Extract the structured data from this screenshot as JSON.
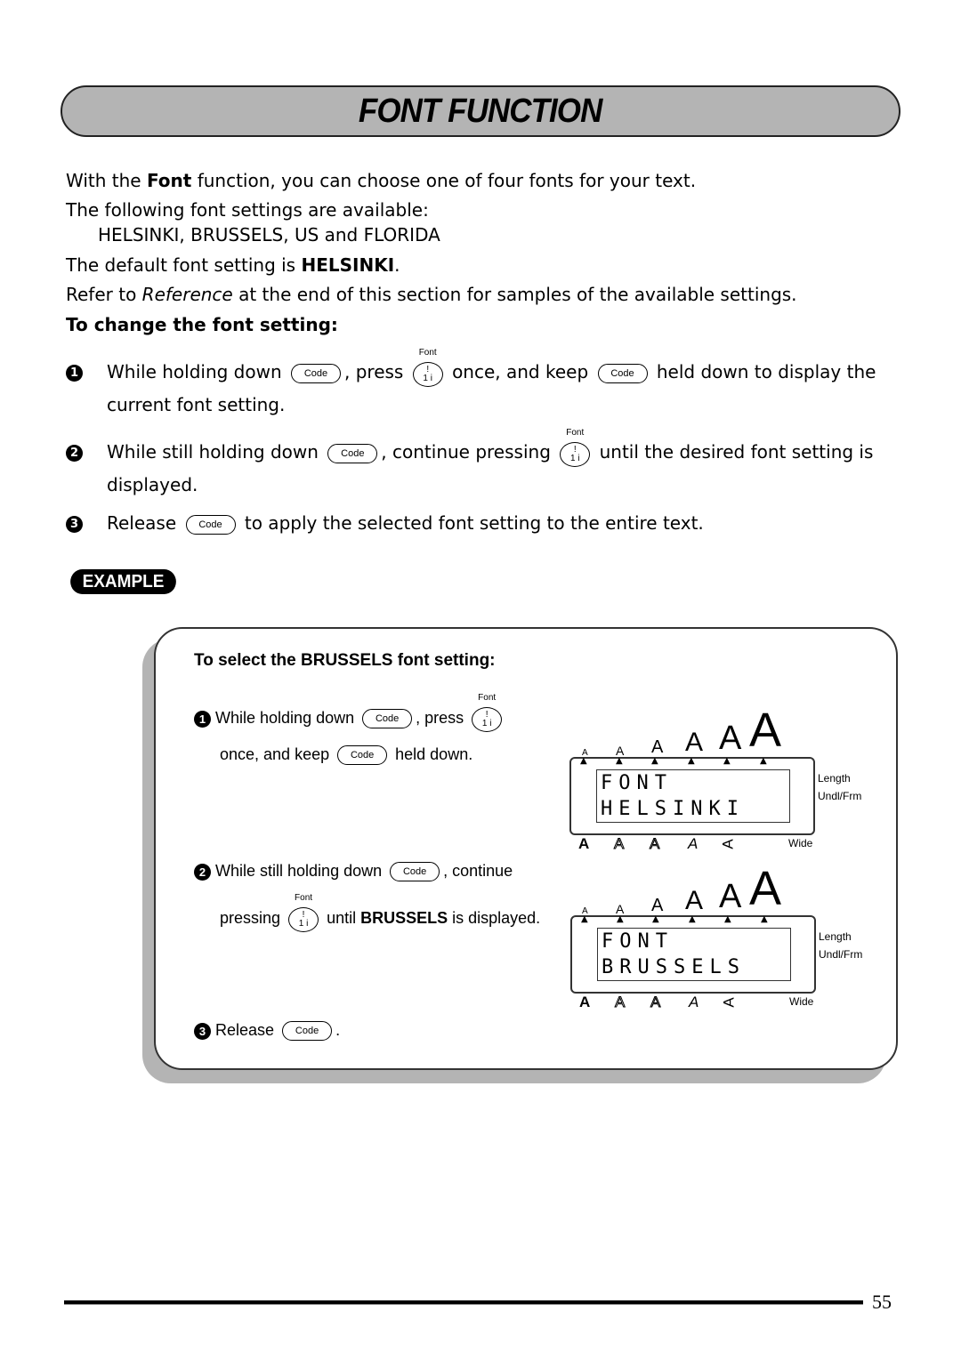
{
  "title": "FONT FUNCTION",
  "intro": {
    "line1_pre": "With the ",
    "line1_bold": "Font",
    "line1_post": " function, you can choose one of four fonts for your text.",
    "line2": "The following font settings are available:",
    "line3": "HELSINKI, BRUSSELS, US and FLORIDA",
    "line4_pre": "The default font setting is ",
    "line4_bold": "HELSINKI",
    "line4_post": ".",
    "line5_pre": "Refer to ",
    "line5_italic": "Reference",
    "line5_post": " at the end of this section for samples of the available settings.",
    "subheading": "To change the font setting:"
  },
  "keys": {
    "code": "Code",
    "font_label": "Font",
    "font_glyph_top": "!",
    "font_glyph_bottom": "1 i"
  },
  "steps": [
    {
      "num": "1",
      "a": "While holding down",
      "b": ", press",
      "c": "once, and keep",
      "d": "held down to display the",
      "e": "current font setting."
    },
    {
      "num": "2",
      "a": "While still holding down",
      "b": ", continue pressing",
      "c": "until the desired font setting is",
      "d": "displayed."
    },
    {
      "num": "3",
      "a": "Release",
      "b": "to apply the selected font setting to the entire text."
    }
  ],
  "example": {
    "badge": "EXAMPLE",
    "title": "To select the BRUSSELS font setting:",
    "step1": {
      "num": "1",
      "a": "While holding down",
      "b": ", press",
      "c": "once, and keep",
      "d": "held down."
    },
    "step2": {
      "num": "2",
      "a": "While still holding down",
      "b": ", continue",
      "c": "pressing",
      "d": "until ",
      "d_bold": "BRUSSELS",
      "e": " is displayed."
    },
    "step3": {
      "num": "3",
      "a": "Release",
      "b": "."
    },
    "lcd1": {
      "line1": "FONT",
      "line2": "HELSINKI"
    },
    "lcd2": {
      "line1": "FONT",
      "line2": "BRUSSELS"
    },
    "size_glyph": "A",
    "arrow_glyph": "▲",
    "side_labels": {
      "length": "Length",
      "undl": "Undl/Frm",
      "wide": "Wide"
    },
    "style_glyphs": [
      "A",
      "A",
      "A",
      "A",
      "A"
    ]
  },
  "page_number": "55"
}
